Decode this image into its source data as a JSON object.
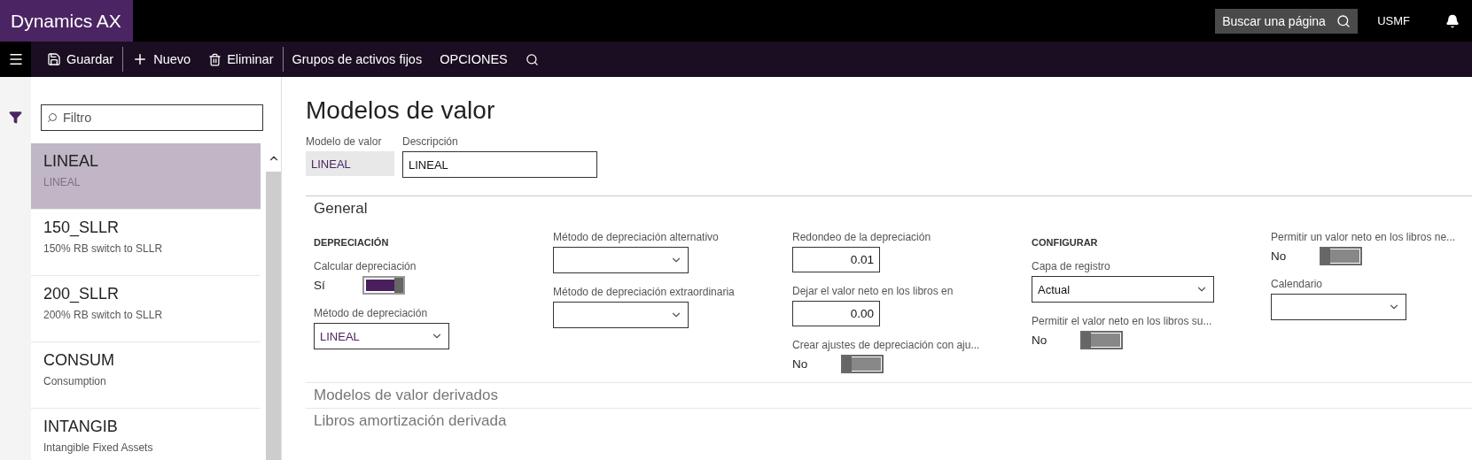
{
  "app": {
    "title": "Dynamics AX",
    "search": {
      "placeholder": "Buscar una página"
    },
    "company": "USMF"
  },
  "actions": [
    {
      "kind": "save",
      "label": "Guardar",
      "divider_after": true
    },
    {
      "kind": "new",
      "label": "Nuevo",
      "divider_after": false
    },
    {
      "kind": "delete",
      "label": "Eliminar",
      "divider_after": true
    },
    {
      "kind": "text",
      "label": "Grupos de activos fijos",
      "divider_after": false
    },
    {
      "kind": "text",
      "label": "OPCIONES",
      "divider_after": false
    },
    {
      "kind": "search",
      "divider_after": false
    }
  ],
  "list": {
    "filter": {
      "placeholder": "Filtro"
    },
    "items": [
      {
        "name": "LINEAL",
        "description": "LINEAL",
        "selected": true
      },
      {
        "name": "150_SLLR",
        "description": "150% RB switch to SLLR",
        "selected": false
      },
      {
        "name": "200_SLLR",
        "description": "200% RB switch to SLLR",
        "selected": false
      },
      {
        "name": "CONSUM",
        "description": "Consumption",
        "selected": false
      },
      {
        "name": "INTANGIB",
        "description": "Intangible Fixed Assets",
        "selected": false
      }
    ]
  },
  "page": {
    "title": "Modelos de valor",
    "header_fields": [
      {
        "kind": "readonly",
        "label": "Modelo de valor",
        "value": "LINEAL"
      },
      {
        "kind": "input",
        "label": "Descripción",
        "value": "LINEAL"
      }
    ],
    "sections": [
      {
        "title": "General",
        "expanded": true,
        "columns": [
          [
            {
              "kind": "heading",
              "label": "DEPRECIACIÓN"
            },
            {
              "kind": "toggle",
              "label": "Calcular depreciación",
              "value": "Sí",
              "on": true
            },
            {
              "kind": "select",
              "label": "Método de depreciación",
              "value": "LINEAL"
            }
          ],
          [
            {
              "kind": "select",
              "label": "Método de depreciación alternativo"
            },
            {
              "kind": "select",
              "label": "Método de depreciación extraordinaria"
            }
          ],
          [
            {
              "kind": "number",
              "label": "Redondeo de la depreciación",
              "value": "0.01"
            },
            {
              "kind": "number",
              "label": "Dejar el valor neto en los libros en",
              "value": "0.00"
            },
            {
              "kind": "toggle",
              "label": "Crear ajustes de depreciación con aju...",
              "value": "No",
              "on": false
            }
          ],
          [
            {
              "kind": "heading",
              "label": "CONFIGURAR"
            },
            {
              "kind": "select",
              "label": "Capa de registro",
              "value": "Actual",
              "plain": true
            },
            {
              "kind": "toggle",
              "label": "Permitir el valor neto en los libros su...",
              "value": "No",
              "on": false
            }
          ],
          [
            {
              "kind": "toggle",
              "label": "Permitir un valor neto en los libros ne...",
              "value": "No",
              "on": false
            },
            {
              "kind": "select",
              "label": "Calendario"
            }
          ]
        ]
      },
      {
        "title": "Modelos de valor derivados",
        "expanded": false
      },
      {
        "title": "Libros amortización derivada",
        "expanded": false
      }
    ]
  }
}
